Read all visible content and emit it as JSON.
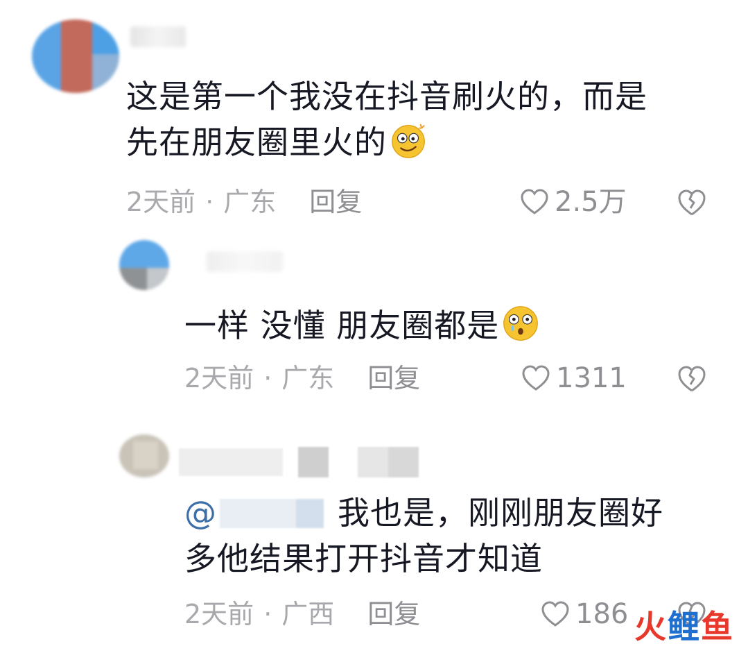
{
  "comments": [
    {
      "text_lines": [
        "这是第一个我没在抖音刷火的，而是",
        "先在朋友圈里火的"
      ],
      "emoji": "dizzy-face-emoji",
      "time": "2天前",
      "location": "广东",
      "reply_label": "回复",
      "likes": "2.5万"
    },
    {
      "text_lines": [
        "一样 没懂 朋友圈都是"
      ],
      "emoji": "shocked-crying-face-emoji",
      "time": "2天前",
      "location": "广东",
      "reply_label": "回复",
      "likes": "1311"
    },
    {
      "mention": "@",
      "text_lines": [
        "我也是，刚刚朋友圈好",
        "多他结果打开抖音才知道"
      ],
      "time": "2天前",
      "location": "广西",
      "reply_label": "回复",
      "likes": "186"
    }
  ],
  "separator": "·",
  "watermark": [
    "火",
    "鲤",
    "鱼"
  ],
  "icons": {
    "like": "heart-outline-icon",
    "dislike": "broken-heart-icon"
  },
  "colors": {
    "text": "#161823",
    "meta": "#a9a9ad",
    "mention": "#3c6ea8",
    "watermark_red": "#e8382c",
    "watermark_blue": "#1f6fd0"
  }
}
